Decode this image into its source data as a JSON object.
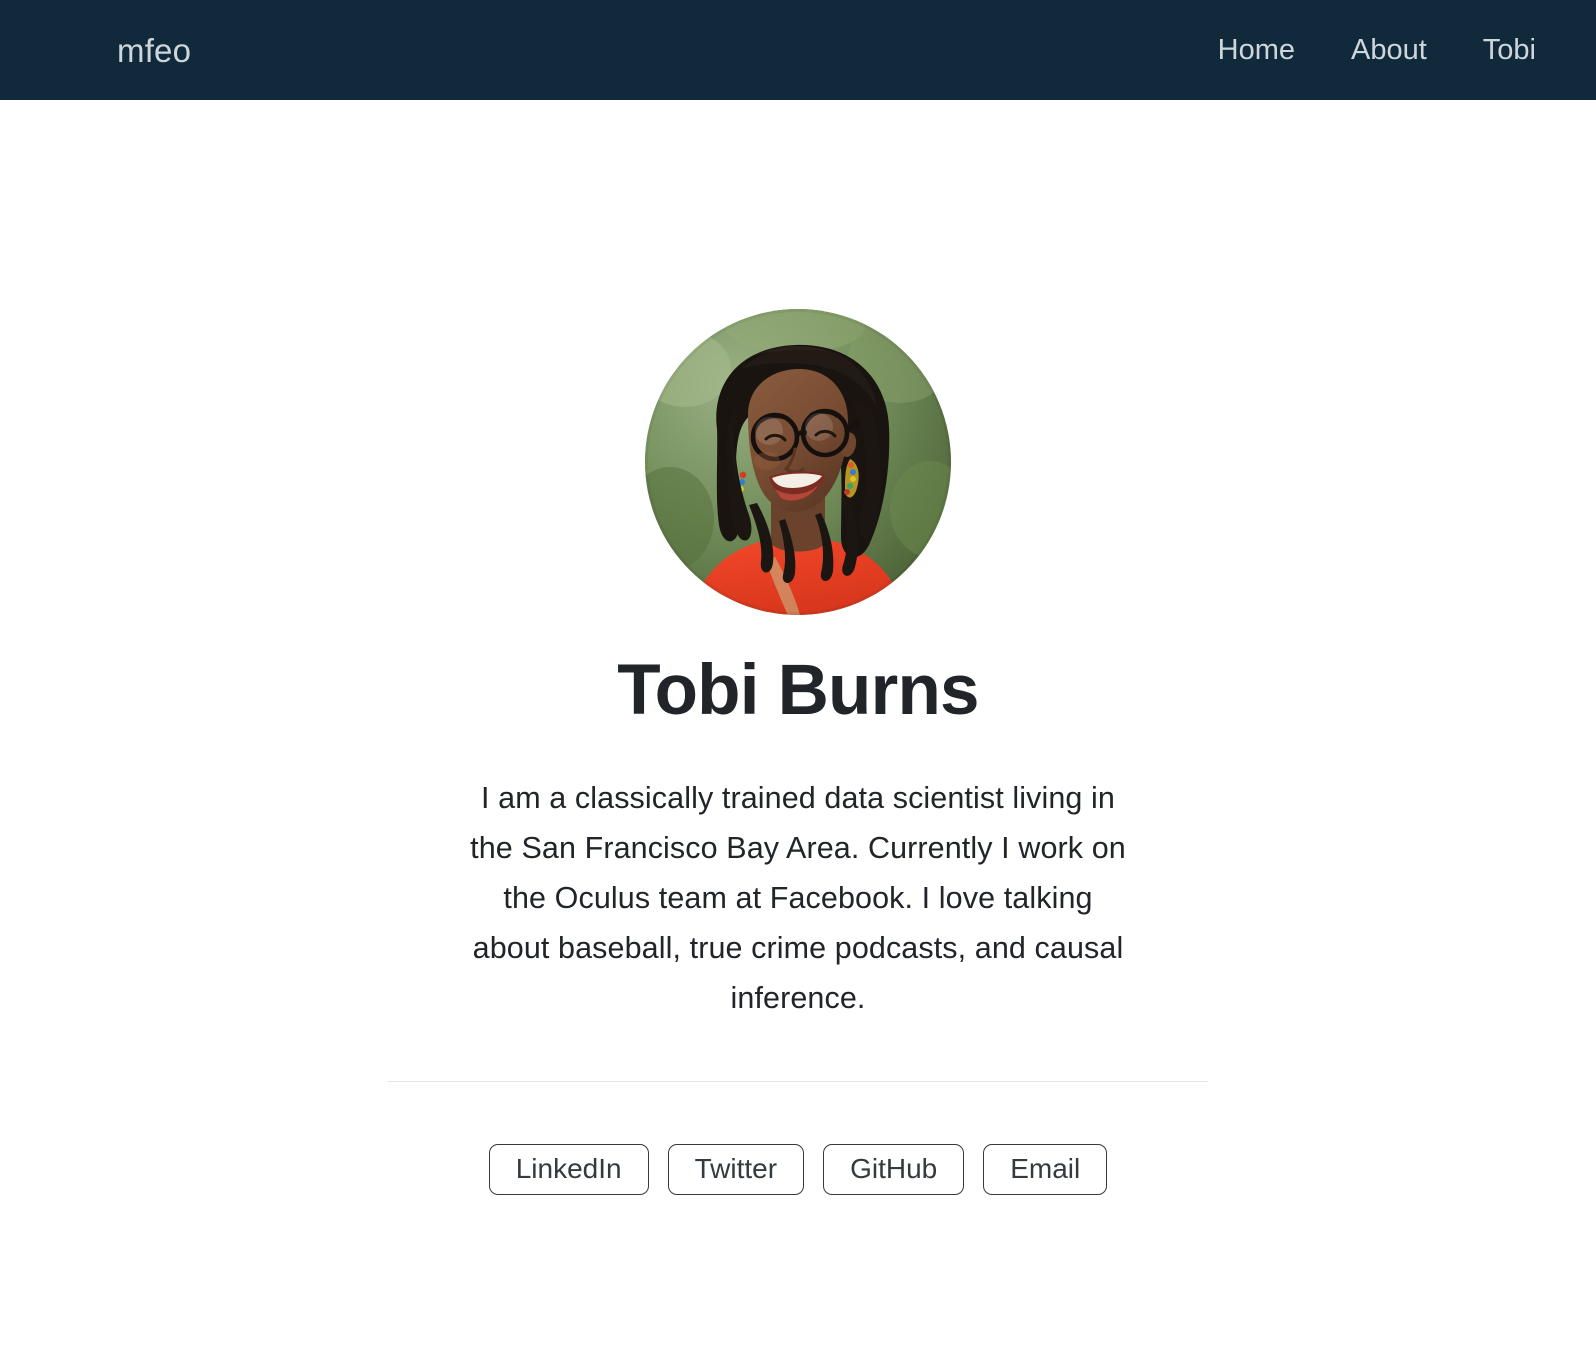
{
  "navbar": {
    "brand": "mfeo",
    "links": [
      {
        "label": "Home",
        "name": "nav-link-home"
      },
      {
        "label": "About",
        "name": "nav-link-about"
      },
      {
        "label": "Tobi",
        "name": "nav-link-tobi"
      }
    ],
    "background_color": "#102a3c",
    "text_color": "#cfd6db"
  },
  "profile": {
    "avatar_alt": "Portrait photo of a smiling woman with locs, round black glasses and colorful beaded earrings, wearing an orange-red top, outdoors against blurred green foliage",
    "name": "Tobi Burns",
    "bio": "I am a classically trained data scientist living in the San Francisco Bay Area. Currently I work on the Oculus team at Facebook. I love talking about baseball, true crime podcasts, and causal inference."
  },
  "links": [
    {
      "label": "LinkedIn",
      "name": "link-button-linkedin"
    },
    {
      "label": "Twitter",
      "name": "link-button-twitter"
    },
    {
      "label": "GitHub",
      "name": "link-button-github"
    },
    {
      "label": "Email",
      "name": "link-button-email"
    }
  ],
  "colors": {
    "page_background": "#ffffff",
    "heading": "#212529",
    "body_text": "#212529",
    "button_border": "#343a40",
    "divider": "#e3e5e7"
  }
}
